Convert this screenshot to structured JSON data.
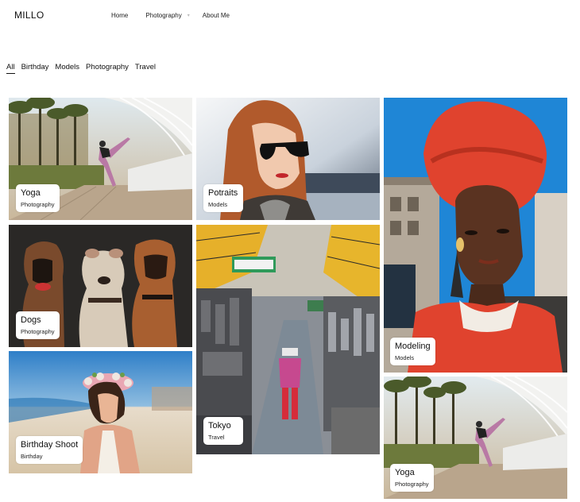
{
  "brand": {
    "name": "MILLO"
  },
  "nav": {
    "items": [
      {
        "label": "Home"
      },
      {
        "label": "Photography",
        "has_dropdown": true,
        "dropdown_icon": "chevron-down-icon"
      },
      {
        "label": "About Me"
      }
    ]
  },
  "filters": {
    "items": [
      {
        "label": "All",
        "active": true
      },
      {
        "label": "Birthday"
      },
      {
        "label": "Models"
      },
      {
        "label": "Photography"
      },
      {
        "label": "Travel"
      }
    ]
  },
  "gallery": {
    "items": [
      {
        "title": "Yoga",
        "category": "Photography"
      },
      {
        "title": "Potraits",
        "category": "Models"
      },
      {
        "title": "Modeling",
        "category": "Models"
      },
      {
        "title": "Dogs",
        "category": "Photography"
      },
      {
        "title": "Tokyo",
        "category": "Travel"
      },
      {
        "title": "Birthday Shoot",
        "category": "Birthday"
      },
      {
        "title": "Yoga",
        "category": "Photography"
      }
    ]
  },
  "colors": {
    "accent_text": "#111111",
    "caption_bg": "#ffffff",
    "headwrap": "#e0432e",
    "dogs_bg": "#2a2826",
    "sky": "#1f86d6"
  }
}
